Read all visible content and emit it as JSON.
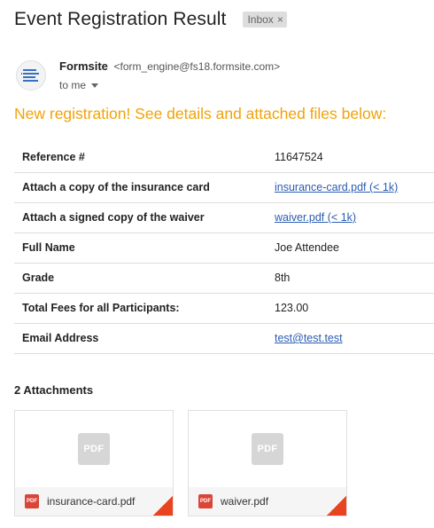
{
  "email": {
    "subject": "Event Registration Result",
    "label": "Inbox",
    "label_close": "×",
    "sender_name": "Formsite",
    "sender_email": "<form_engine@fs18.formsite.com>",
    "recipient": "to me",
    "headline": "New registration! See details and attached files below:"
  },
  "fields": [
    {
      "label": "Reference #",
      "value": "11647524",
      "link": false
    },
    {
      "label": "Attach a copy of the insurance card",
      "value": "insurance-card.pdf (< 1k)",
      "link": true
    },
    {
      "label": "Attach a signed copy of the waiver",
      "value": "waiver.pdf (< 1k)",
      "link": true
    },
    {
      "label": "Full Name",
      "value": "Joe Attendee",
      "link": false
    },
    {
      "label": "Grade",
      "value": "8th",
      "link": false
    },
    {
      "label": "Total Fees for all Participants:",
      "value": "123.00",
      "link": false
    },
    {
      "label": "Email Address",
      "value": "test@test.test",
      "link": true
    }
  ],
  "attachments": {
    "heading": "2 Attachments",
    "items": [
      {
        "name": "insurance-card.pdf",
        "preview_badge": "PDF",
        "type_badge": "PDF"
      },
      {
        "name": "waiver.pdf",
        "preview_badge": "PDF",
        "type_badge": "PDF"
      }
    ]
  },
  "colors": {
    "headline": "#f0a30a",
    "link": "#2a5db0",
    "pdf_red": "#db4437",
    "corner_orange": "#e8441f"
  },
  "icons": {
    "avatar": "formsite-logo-icon",
    "caret": "chevron-down-icon",
    "attachment": "pdf-icon"
  }
}
